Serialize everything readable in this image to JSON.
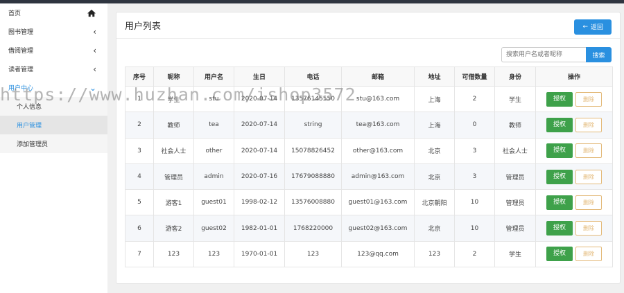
{
  "sidebar": {
    "items": [
      {
        "label": "首页"
      },
      {
        "label": "图书管理"
      },
      {
        "label": "借阅管理"
      },
      {
        "label": "读者管理"
      },
      {
        "label": "用户中心"
      }
    ],
    "sub_items": [
      {
        "label": "个人信息"
      },
      {
        "label": "用户管理"
      },
      {
        "label": "添加管理员"
      }
    ]
  },
  "panel": {
    "title": "用户列表",
    "back_label": "返回"
  },
  "search": {
    "placeholder": "搜索用户名或者昵称",
    "button_label": "搜索"
  },
  "table": {
    "headers": [
      "序号",
      "昵称",
      "用户名",
      "生日",
      "电话",
      "邮箱",
      "地址",
      "可借数量",
      "身份",
      "操作"
    ],
    "rows": [
      {
        "id": "1",
        "nickname": "学生",
        "username": "stu",
        "birthday": "2020-07-14",
        "phone": "13576145550",
        "email": "stu@163.com",
        "address": "上海",
        "quota": "2",
        "role": "学生"
      },
      {
        "id": "2",
        "nickname": "教师",
        "username": "tea",
        "birthday": "2020-07-14",
        "phone": "string",
        "email": "tea@163.com",
        "address": "上海",
        "quota": "0",
        "role": "教师"
      },
      {
        "id": "3",
        "nickname": "社会人士",
        "username": "other",
        "birthday": "2020-07-14",
        "phone": "15078826452",
        "email": "other@163.com",
        "address": "北京",
        "quota": "3",
        "role": "社会人士"
      },
      {
        "id": "4",
        "nickname": "管理员",
        "username": "admin",
        "birthday": "2020-07-16",
        "phone": "17679088880",
        "email": "admin@163.com",
        "address": "北京",
        "quota": "3",
        "role": "管理员"
      },
      {
        "id": "5",
        "nickname": "游客1",
        "username": "guest01",
        "birthday": "1998-02-12",
        "phone": "13576008880",
        "email": "guest01@163.com",
        "address": "北京朝阳",
        "quota": "10",
        "role": "管理员"
      },
      {
        "id": "6",
        "nickname": "游客2",
        "username": "guest02",
        "birthday": "1982-01-01",
        "phone": "1768220000",
        "email": "guest02@163.com",
        "address": "北京",
        "quota": "10",
        "role": "管理员"
      },
      {
        "id": "7",
        "nickname": "123",
        "username": "123",
        "birthday": "1970-01-01",
        "phone": "123",
        "email": "123@qq.com",
        "address": "123",
        "quota": "2",
        "role": "学生"
      }
    ],
    "auth_label": "授权",
    "delete_label": "删除"
  },
  "watermark": "https://www.huzhan.com/ishop3572",
  "colors": {
    "primary": "#2a90e0",
    "success": "#3ea14a",
    "warning_outline": "#e3b978",
    "topbar": "#2f3540"
  }
}
